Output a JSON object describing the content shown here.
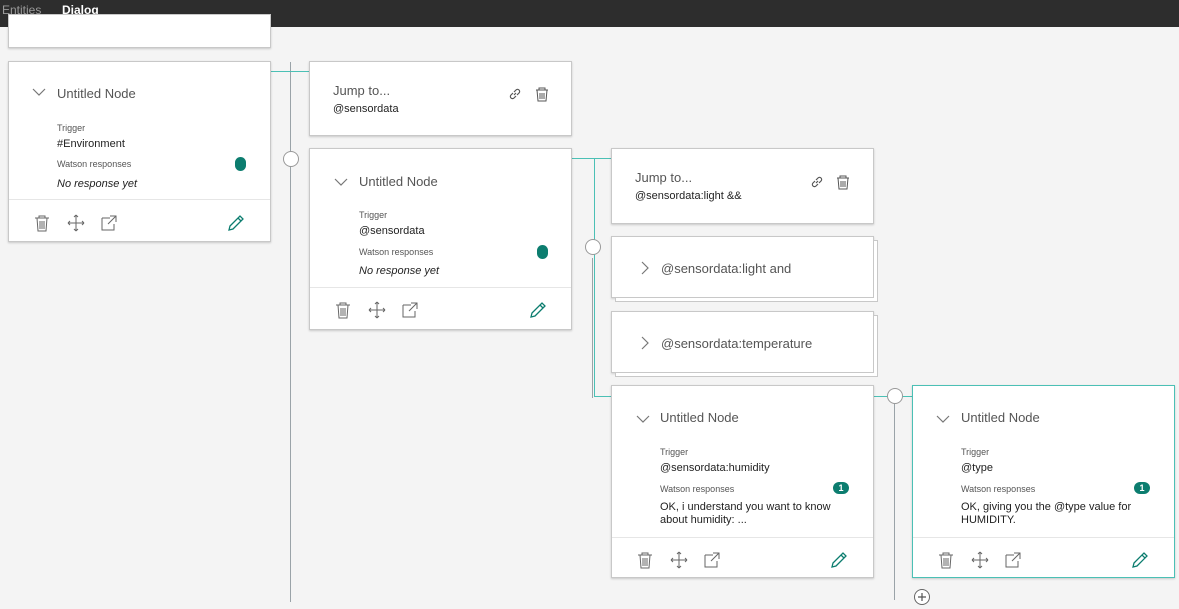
{
  "tabs": [
    {
      "label": "Entities"
    },
    {
      "label": "Dialog",
      "active": true
    }
  ],
  "colors": {
    "accent": "#0f9b8e",
    "badge": "#0c7d6f",
    "connector": "#4bc0b5"
  },
  "nodes": {
    "environment": {
      "title": "Untitled Node",
      "trigger_label": "Trigger",
      "trigger": "#Environment",
      "responses_label": "Watson responses",
      "response": "No response yet"
    },
    "sensordata": {
      "title": "Untitled Node",
      "trigger_label": "Trigger",
      "trigger": "@sensordata",
      "responses_label": "Watson responses",
      "response": "No response yet"
    },
    "humidity": {
      "title": "Untitled Node",
      "trigger_label": "Trigger",
      "trigger": "@sensordata:humidity",
      "responses_label": "Watson responses",
      "response_count": "1",
      "response": "OK, i understand you want to know about humidity: ..."
    },
    "type": {
      "title": "Untitled Node",
      "trigger_label": "Trigger",
      "trigger": "@type",
      "responses_label": "Watson responses",
      "response_count": "1",
      "response": "OK, giving you the @type value for HUMIDITY."
    }
  },
  "jumps": {
    "jump1": {
      "title": "Jump to...",
      "target": "@sensordata"
    },
    "jump2": {
      "title": "Jump to...",
      "target": "@sensordata:light &&"
    }
  },
  "folders": {
    "light": {
      "label": "@sensordata:light and"
    },
    "temperature": {
      "label": "@sensordata:temperature"
    }
  }
}
